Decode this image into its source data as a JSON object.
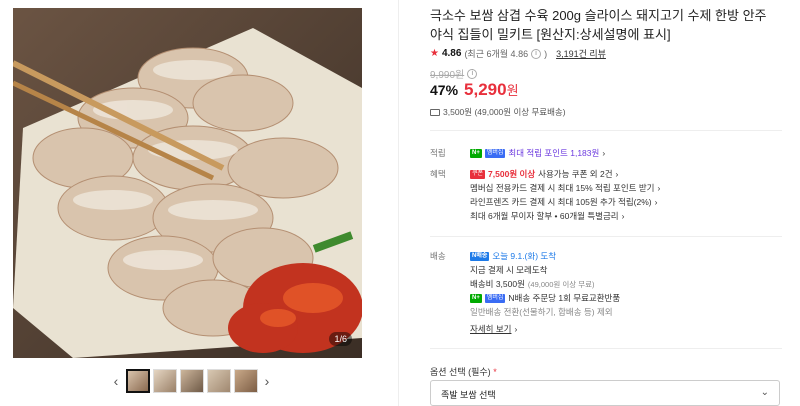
{
  "gallery": {
    "counter": "1/6",
    "prev_icon": "chevron-left-icon",
    "next_icon": "chevron-right-icon",
    "thumb_count": 5
  },
  "product": {
    "title": "극소수 보쌈 삼겹 수육 200g 슬라이스 돼지고기 수제 한방 안주 야식 집들이 밀키트 [원산지:상세설명에 표시]",
    "rating": "4.86",
    "rating_recent": "(최근 6개월 4.86",
    "review_count": "3,191건 리뷰",
    "original_price": "9,990원",
    "discount_rate": "47%",
    "sale_price": "5,290",
    "won": "원",
    "shipping_summary": "3,500원 (49,000원 이상 무료배송)"
  },
  "benefits": {
    "points_label": "적립",
    "n_badge": "N+",
    "membership_badge": "멤버십",
    "points_text": "최대 적립 포인트 1,183원",
    "benefit_label": "혜택",
    "coupon_badge": "쿠폰",
    "coupon_amount": "7,500원 이상",
    "coupon_text": "사용가능 쿠폰 외 2건",
    "line2": "멤버십 전용카드 결제 시 최대 15% 적립 포인트 받기",
    "line3": "라인프렌즈 카드 결제 시 최대 105원 추가 적립(2%)",
    "line4": "최대 6개월 무이자 할부 • 60개월 특별금리"
  },
  "delivery": {
    "label": "배송",
    "n_delivery_badge": "N배송",
    "arrival": "오늘 9.1.(화) 도착",
    "line2": "지금 결제 시 모레도착",
    "fee": "배송비 3,500원",
    "fee_note": "(49,000원 이상 무료)",
    "exchange": "N배송 주문당 1회 무료교환반품",
    "general": "일반배송 전환(선물하기, 합배송 등) 제외",
    "detail_link": "자세히 보기"
  },
  "option": {
    "label": "옵션 선택 (필수)",
    "required_mark": "*",
    "selected": "족발 보쌈 선택"
  }
}
